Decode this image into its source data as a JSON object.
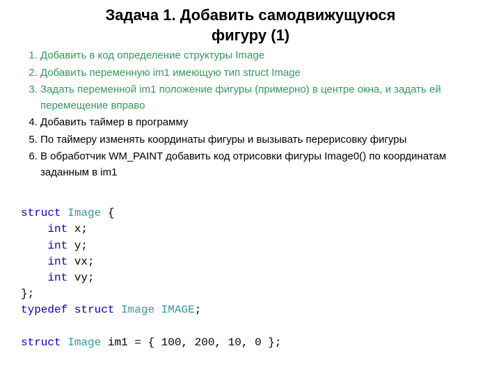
{
  "title_line1": "Задача 1.  Добавить самодвижущуюся",
  "title_line2": "фигуру (1)",
  "items": [
    {
      "cls": "li-green",
      "text": "Добавить в код определение структуры Image"
    },
    {
      "cls": "li-green",
      "text": "Добавить переменную im1 имеющую тип struct Image"
    },
    {
      "cls": "li-green",
      "text": "Задать переменной im1 положение фигуры (примерно) в центре окна, и задать ей перемещение вправо"
    },
    {
      "cls": "li-black",
      "text": "Добавить таймер в программу"
    },
    {
      "cls": "li-black",
      "text": "По таймеру изменять координаты фигуры  и вызывать перерисовку фигуры"
    },
    {
      "cls": "li-black",
      "text": "В обработчик WM_PAINT добавить код отрисовки фигуры Image0() по координатам заданным в im1"
    }
  ],
  "code": {
    "kw_struct": "struct",
    "kw_int": "int",
    "kw_typedef": "typedef",
    "typ_Image": "Image",
    "typ_IMAGE": "IMAGE",
    "fx": "x;",
    "fy": "y;",
    "fvx": "vx;",
    "fvy": "vy;",
    "brace_open": " {",
    "brace_close": "};",
    "im1_decl": " im1 = { 100, 200, 10, 0 };",
    "semi": ";"
  }
}
